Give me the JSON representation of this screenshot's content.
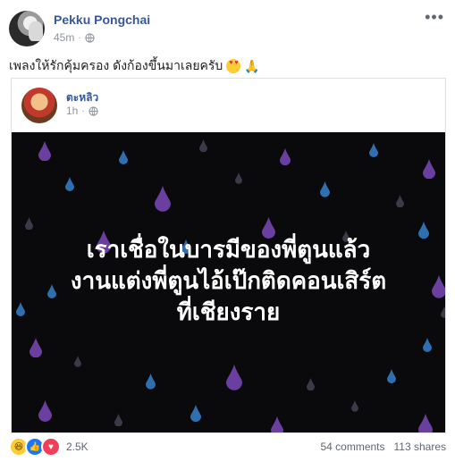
{
  "post": {
    "author": "Pekku Pongchai",
    "time": "45m",
    "caption": "เพลงให้รักคุ้มครอง ดังก้องขึ้นมาเลยครับ"
  },
  "shared": {
    "author": "ตะหลิว",
    "time": "1h",
    "image_lines": [
      "เราเชื่อในบารมีของพี่ตูนแล้ว",
      "งานแต่งพี่ตูนไอ้เป๊กติดคอนเสิร์ต",
      "ที่เชียงราย"
    ]
  },
  "footer": {
    "reaction_count": "2.5K",
    "comments": "54 comments",
    "shares": "113 shares"
  },
  "colors": {
    "link": "#385898",
    "meta": "#90949c",
    "image_bg": "#0a0a0c",
    "drop_purple": "#6b3fa0",
    "drop_blue": "#2e6fb0",
    "drop_gray": "#3a3a48"
  }
}
